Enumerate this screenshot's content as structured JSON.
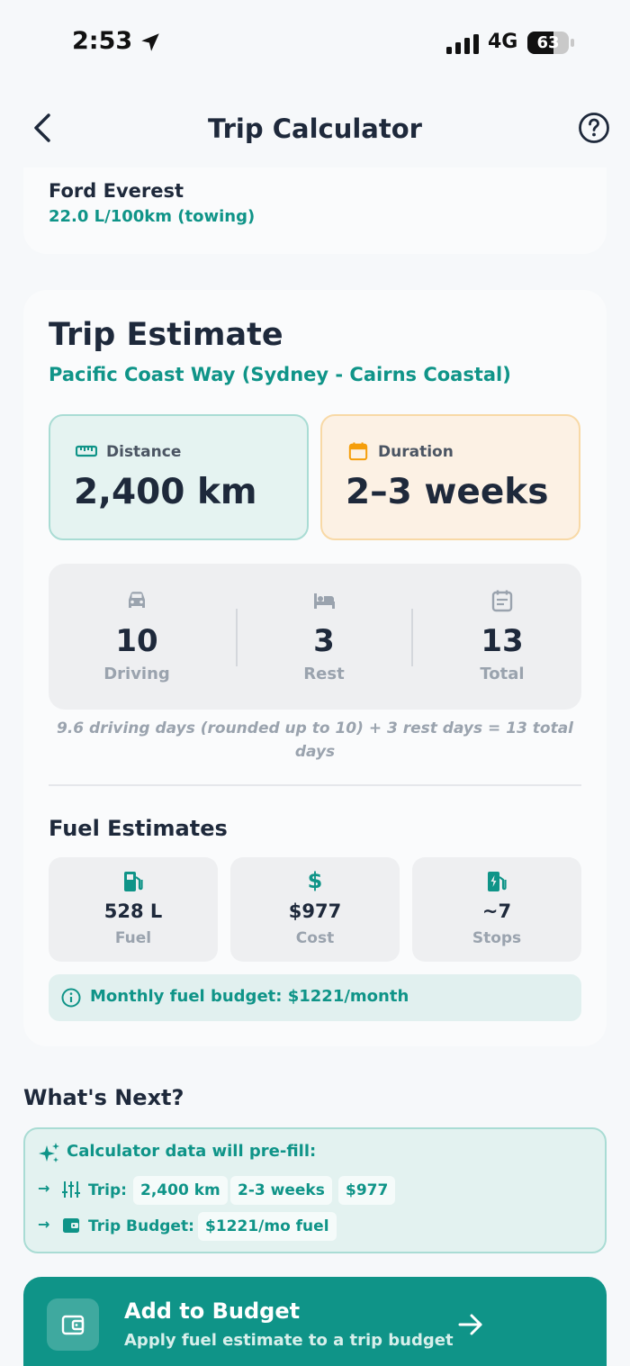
{
  "status_bar": {
    "time": "2:53",
    "network": "4G",
    "battery": "63",
    "battery_level": 0.63
  },
  "nav": {
    "title": "Trip Calculator"
  },
  "vehicle": {
    "name": "Ford Everest",
    "efficiency": "22.0 L/100km (towing)"
  },
  "estimate": {
    "title": "Trip Estimate",
    "route": "Pacific Coast Way (Sydney - Cairns Coastal)",
    "distance": {
      "label": "Distance",
      "value": "2,400 km",
      "icon": "ruler-icon"
    },
    "duration": {
      "label": "Duration",
      "value": "2–3 weeks",
      "icon": "calendar-icon"
    },
    "days": [
      {
        "value": "10",
        "label": "Driving",
        "icon": "car-icon"
      },
      {
        "value": "3",
        "label": "Rest",
        "icon": "bed-icon"
      },
      {
        "value": "13",
        "label": "Total",
        "icon": "calendar-icon"
      }
    ],
    "note": "9.6 driving days (rounded up to 10) + 3 rest days = 13 total days"
  },
  "fuel": {
    "title": "Fuel Estimates",
    "items": [
      {
        "value": "528 L",
        "label": "Fuel",
        "icon": "fuel-pump-icon"
      },
      {
        "value": "$977",
        "label": "Cost",
        "icon": "dollar-icon",
        "glyph": "$"
      },
      {
        "value": "~7",
        "label": "Stops",
        "icon": "charging-station-icon"
      }
    ],
    "monthly_budget": "Monthly fuel budget: $1221/month"
  },
  "whats_next": {
    "title": "What's Next?",
    "header": "Calculator data will pre-fill:",
    "trip_row": {
      "label": "Trip:",
      "chips": [
        "2,400 km",
        "2-3 weeks",
        "$977"
      ]
    },
    "budget_row": {
      "label": "Trip Budget:",
      "chips": [
        "$1221/mo fuel"
      ]
    },
    "arrow": "→"
  },
  "cta": {
    "title": "Add to Budget",
    "subtitle": "Apply fuel estimate to a trip budget"
  },
  "colors": {
    "accent": "#0f9488",
    "duration_bg": "#fcf1e4",
    "distance_bg": "#e5f3f1",
    "duration_icon": "#f59e0b"
  }
}
